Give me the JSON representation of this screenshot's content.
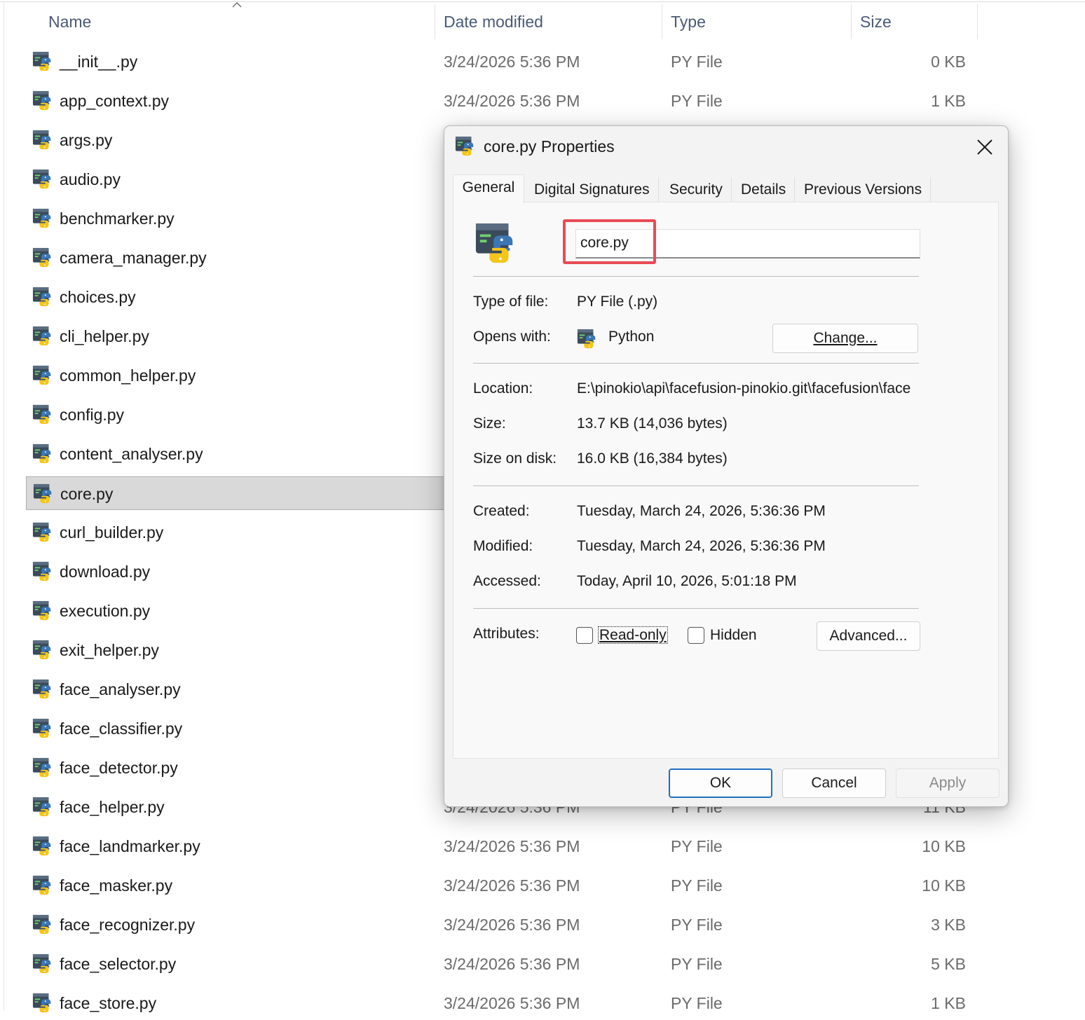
{
  "columns": {
    "name": "Name",
    "date_modified": "Date modified",
    "type": "Type",
    "size": "Size"
  },
  "files": [
    {
      "name": "__init__.py",
      "date": "3/24/2026 5:36 PM",
      "type": "PY File",
      "size": "0 KB"
    },
    {
      "name": "app_context.py",
      "date": "3/24/2026 5:36 PM",
      "type": "PY File",
      "size": "1 KB"
    },
    {
      "name": "args.py",
      "date": "",
      "type": "",
      "size": ""
    },
    {
      "name": "audio.py",
      "date": "",
      "type": "",
      "size": ""
    },
    {
      "name": "benchmarker.py",
      "date": "",
      "type": "",
      "size": ""
    },
    {
      "name": "camera_manager.py",
      "date": "",
      "type": "",
      "size": ""
    },
    {
      "name": "choices.py",
      "date": "",
      "type": "",
      "size": ""
    },
    {
      "name": "cli_helper.py",
      "date": "",
      "type": "",
      "size": ""
    },
    {
      "name": "common_helper.py",
      "date": "",
      "type": "",
      "size": ""
    },
    {
      "name": "config.py",
      "date": "",
      "type": "",
      "size": ""
    },
    {
      "name": "content_analyser.py",
      "date": "",
      "type": "",
      "size": ""
    },
    {
      "name": "core.py",
      "date": "",
      "type": "",
      "size": "",
      "selected": true
    },
    {
      "name": "curl_builder.py",
      "date": "",
      "type": "",
      "size": ""
    },
    {
      "name": "download.py",
      "date": "",
      "type": "",
      "size": ""
    },
    {
      "name": "execution.py",
      "date": "",
      "type": "",
      "size": ""
    },
    {
      "name": "exit_helper.py",
      "date": "",
      "type": "",
      "size": ""
    },
    {
      "name": "face_analyser.py",
      "date": "",
      "type": "",
      "size": ""
    },
    {
      "name": "face_classifier.py",
      "date": "",
      "type": "",
      "size": ""
    },
    {
      "name": "face_detector.py",
      "date": "",
      "type": "",
      "size": ""
    },
    {
      "name": "face_helper.py",
      "date": "3/24/2026 5:36 PM",
      "type": "PY File",
      "size": "11 KB"
    },
    {
      "name": "face_landmarker.py",
      "date": "3/24/2026 5:36 PM",
      "type": "PY File",
      "size": "10 KB"
    },
    {
      "name": "face_masker.py",
      "date": "3/24/2026 5:36 PM",
      "type": "PY File",
      "size": "10 KB"
    },
    {
      "name": "face_recognizer.py",
      "date": "3/24/2026 5:36 PM",
      "type": "PY File",
      "size": "3 KB"
    },
    {
      "name": "face_selector.py",
      "date": "3/24/2026 5:36 PM",
      "type": "PY File",
      "size": "5 KB"
    },
    {
      "name": "face_store.py",
      "date": "3/24/2026 5:36 PM",
      "type": "PY File",
      "size": "1 KB"
    }
  ],
  "dialog": {
    "title": "core.py Properties",
    "tabs": [
      "General",
      "Digital Signatures",
      "Security",
      "Details",
      "Previous Versions"
    ],
    "active_tab": "General",
    "file_name": "core.py",
    "type_of_file_label": "Type of file:",
    "type_of_file": "PY File (.py)",
    "opens_with_label": "Opens with:",
    "opens_with": "Python",
    "change_button": "Change...",
    "location_label": "Location:",
    "location": "E:\\pinokio\\api\\facefusion-pinokio.git\\facefusion\\face",
    "size_label": "Size:",
    "size": "13.7 KB (14,036 bytes)",
    "size_on_disk_label": "Size on disk:",
    "size_on_disk": "16.0 KB (16,384 bytes)",
    "created_label": "Created:",
    "created": "Tuesday, March 24, 2026, 5:36:36 PM",
    "modified_label": "Modified:",
    "modified": "Tuesday, March 24, 2026, 5:36:36 PM",
    "accessed_label": "Accessed:",
    "accessed": "Today, April 10, 2026, 5:01:18 PM",
    "attributes_label": "Attributes:",
    "readonly_label": "Read-only",
    "readonly_checked": false,
    "hidden_label": "Hidden",
    "hidden_checked": false,
    "advanced_button": "Advanced...",
    "ok_button": "OK",
    "cancel_button": "Cancel",
    "apply_button": "Apply"
  },
  "colors": {
    "highlight_border": "#e94b55",
    "ok_border": "#1d6fc1",
    "selected_row": "#d9d9d9"
  }
}
